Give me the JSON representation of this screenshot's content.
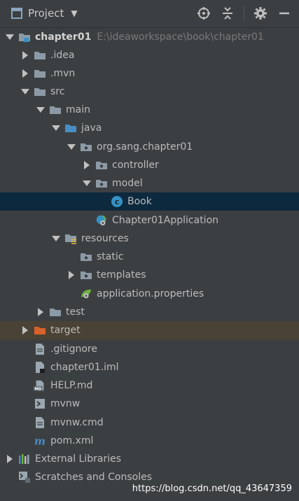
{
  "header": {
    "title": "Project",
    "icon": "project-view-icon",
    "actions": [
      "locate-icon",
      "collapse-all-icon",
      "settings-gear-icon",
      "hide-minus-icon"
    ]
  },
  "tree": [
    {
      "label": "chapter01",
      "path": "E:\\ideaworkspace\\book\\chapter01",
      "icon": "module-folder-icon",
      "expanded": true
    },
    {
      "label": ".idea",
      "icon": "folder-icon",
      "expanded": false
    },
    {
      "label": ".mvn",
      "icon": "folder-icon",
      "expanded": false
    },
    {
      "label": "src",
      "icon": "folder-icon",
      "expanded": true
    },
    {
      "label": "main",
      "icon": "folder-icon",
      "expanded": true
    },
    {
      "label": "java",
      "icon": "source-folder-icon",
      "expanded": true
    },
    {
      "label": "org.sang.chapter01",
      "icon": "package-icon",
      "expanded": true
    },
    {
      "label": "controller",
      "icon": "package-icon",
      "expanded": false
    },
    {
      "label": "model",
      "icon": "package-icon",
      "expanded": true
    },
    {
      "label": "Book",
      "icon": "java-class-icon",
      "selected": true
    },
    {
      "label": "Chapter01Application",
      "icon": "spring-boot-class-icon"
    },
    {
      "label": "resources",
      "icon": "resources-folder-icon",
      "expanded": true
    },
    {
      "label": "static",
      "icon": "package-icon"
    },
    {
      "label": "templates",
      "icon": "package-icon",
      "expanded": false
    },
    {
      "label": "application.properties",
      "icon": "spring-properties-icon"
    },
    {
      "label": "test",
      "icon": "folder-icon",
      "expanded": false
    },
    {
      "label": "target",
      "icon": "excluded-folder-icon",
      "expanded": false
    },
    {
      "label": ".gitignore",
      "icon": "text-file-icon"
    },
    {
      "label": "chapter01.iml",
      "icon": "iml-file-icon"
    },
    {
      "label": "HELP.md",
      "icon": "markdown-file-icon"
    },
    {
      "label": "mvnw",
      "icon": "shell-script-icon"
    },
    {
      "label": "mvnw.cmd",
      "icon": "text-file-icon"
    },
    {
      "label": "pom.xml",
      "icon": "maven-pom-icon"
    },
    {
      "label": "External Libraries",
      "icon": "libraries-icon",
      "expanded": false
    },
    {
      "label": "Scratches and Consoles",
      "icon": "scratches-icon"
    }
  ],
  "watermark": "https://blog.csdn.net/qq_43647359",
  "colors": {
    "background": "#3c3f41",
    "selection": "#0d293e",
    "excluded_row": "#4a4234",
    "folder": "#8c9aa6",
    "source_folder": "#4a8dc4",
    "excluded_folder": "#d9622b",
    "class_icon": "#3592c4"
  }
}
